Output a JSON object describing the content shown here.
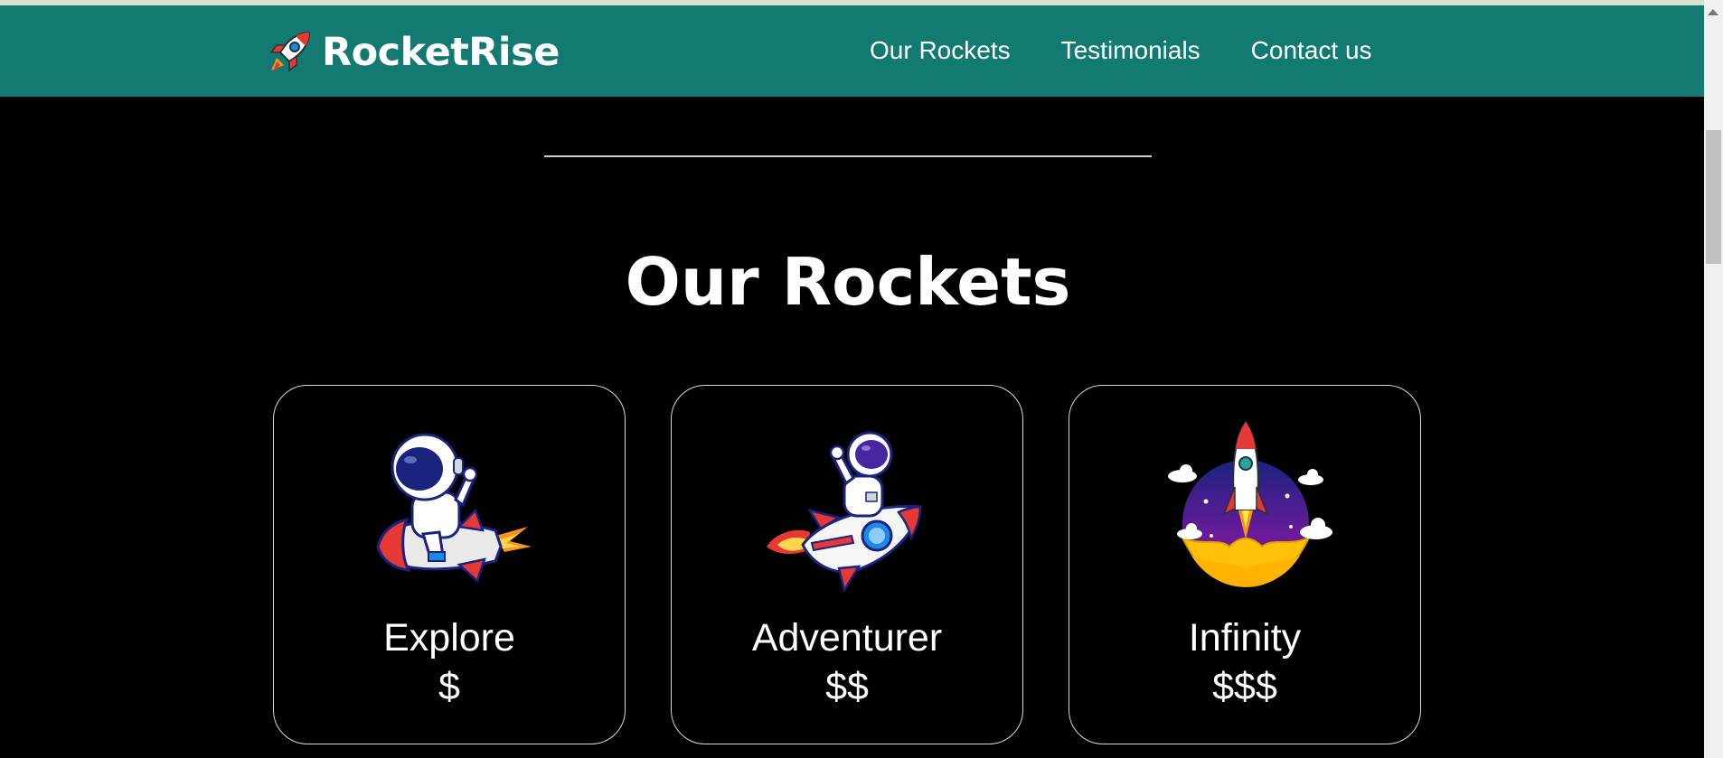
{
  "brand": {
    "name": "RocketRise",
    "logo_icon": "rocket-icon"
  },
  "nav": {
    "links": [
      {
        "label": "Our Rockets"
      },
      {
        "label": "Testimonials"
      },
      {
        "label": "Contact us"
      }
    ]
  },
  "section": {
    "title": "Our Rockets"
  },
  "cards": [
    {
      "name": "Explore",
      "price": "$",
      "image": "astronaut-riding-rocket-icon"
    },
    {
      "name": "Adventurer",
      "price": "$$",
      "image": "astronaut-waving-on-rocket-icon"
    },
    {
      "name": "Infinity",
      "price": "$$$",
      "image": "rocket-launch-icon"
    }
  ],
  "colors": {
    "navbar": "#127a70",
    "background": "#000000",
    "text": "#ffffff",
    "card_border": "#d9d9d9"
  }
}
